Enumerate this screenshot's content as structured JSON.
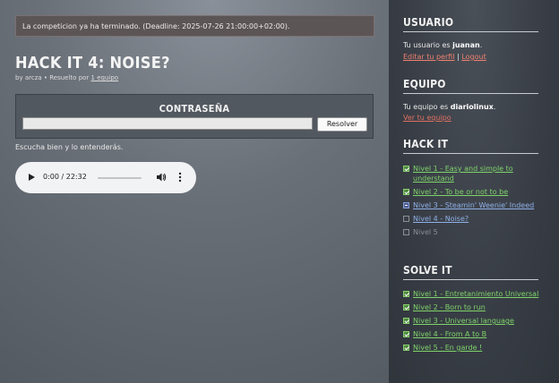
{
  "alert": "La competicion ya ha terminado. (Deadline: 2025-07-26 21:00:00+02:00).",
  "challenge": {
    "title": "Hack it 4: Noise?",
    "by_prefix": "by",
    "author": "arcza",
    "solved_prefix": "• Resuelto por",
    "solved_link": "1 equipo"
  },
  "password": {
    "label": "CONTRASEÑA",
    "button": "Resolver"
  },
  "hint": "Escucha bien y lo entenderás.",
  "audio": {
    "time": "0:00 / 22:32",
    "play_icon": "play-icon",
    "volume_icon": "volume-icon",
    "more_icon": "more-vert-icon"
  },
  "sidebar": {
    "usuario": {
      "heading": "USUARIO",
      "text": "Tu usuario es",
      "name": "juanan",
      "edit": "Editar tu perfil",
      "sep": "|",
      "logout": "Logout"
    },
    "equipo": {
      "heading": "EQUIPO",
      "text": "Tu equipo es",
      "name": "diariolinux",
      "link": "Ver tu equipo"
    },
    "hackit": {
      "heading": "HACK IT",
      "items": [
        {
          "label": "Nivel 1 - Easy and simple to understand",
          "state": "solved"
        },
        {
          "label": "Nivel 2 - To be or not to be",
          "state": "solved"
        },
        {
          "label": "Nivel 3 - Steamin' Weenie' Indeed",
          "state": "partial"
        },
        {
          "label": "Nivel 4 - Noise?",
          "state": "open"
        },
        {
          "label": "Nivel 5",
          "state": "locked"
        }
      ]
    },
    "solveit": {
      "heading": "SOLVE IT",
      "items": [
        {
          "label": "Nivel 1 - Entretanimiento Universal",
          "state": "solved"
        },
        {
          "label": "Nivel 2 - Born to run",
          "state": "solved"
        },
        {
          "label": "Nivel 3 - Universal language",
          "state": "solved"
        },
        {
          "label": "Nivel 4 - From A to B",
          "state": "solved"
        },
        {
          "label": "Nivel 5 - En garde !",
          "state": "solved"
        }
      ]
    }
  },
  "colors": {
    "accent_red": "#f08070",
    "solved_green": "#7fd36a",
    "partial_blue": "#8fb0e8"
  }
}
